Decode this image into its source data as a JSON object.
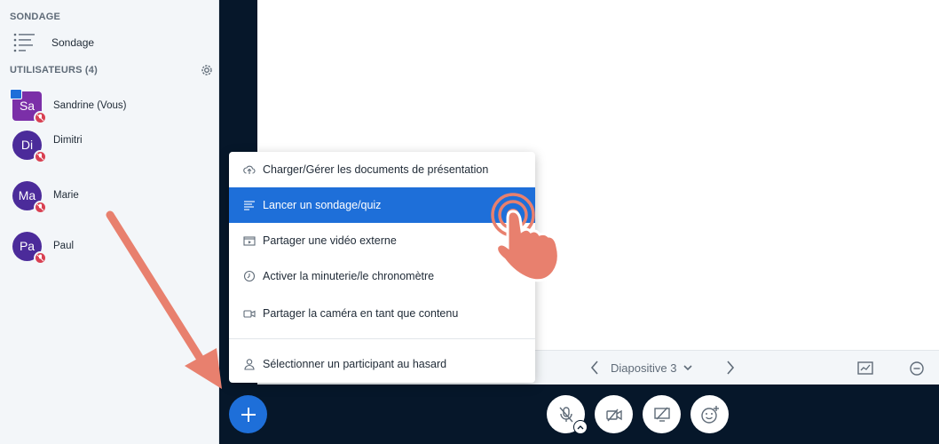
{
  "sidebar": {
    "poll_section_title": "SONDAGE",
    "poll_item_label": "Sondage",
    "users_section_title": "UTILISATEURS (4)",
    "users": [
      {
        "initials": "Sa",
        "name": "Sandrine (Vous)"
      },
      {
        "initials": "Di",
        "name": "Dimitri"
      },
      {
        "initials": "Ma",
        "name": "Marie"
      },
      {
        "initials": "Pa",
        "name": "Paul"
      }
    ]
  },
  "slide_toolbar": {
    "slide_label": "Diapositive 3"
  },
  "actions_menu": {
    "items": [
      {
        "label": "Charger/Gérer les documents de présentation",
        "icon": "upload-cloud-icon"
      },
      {
        "label": "Lancer un sondage/quiz",
        "icon": "poll-list-icon"
      },
      {
        "label": "Partager une vidéo externe",
        "icon": "external-video-icon"
      },
      {
        "label": "Activer la minuterie/le chronomètre",
        "icon": "timer-icon"
      },
      {
        "label": "Partager la caméra en tant que contenu",
        "icon": "camera-icon"
      },
      {
        "label": "Sélectionner un participant au hasard",
        "icon": "user-icon"
      }
    ],
    "active_index": 1
  },
  "colors": {
    "accent": "#1e6fd9",
    "dark_bg": "#06172a",
    "sidebar_bg": "#f3f6f9",
    "avatar_purple": "#4b2b9a",
    "mute_red": "#d94052",
    "arrow_salmon": "#e8806e"
  }
}
